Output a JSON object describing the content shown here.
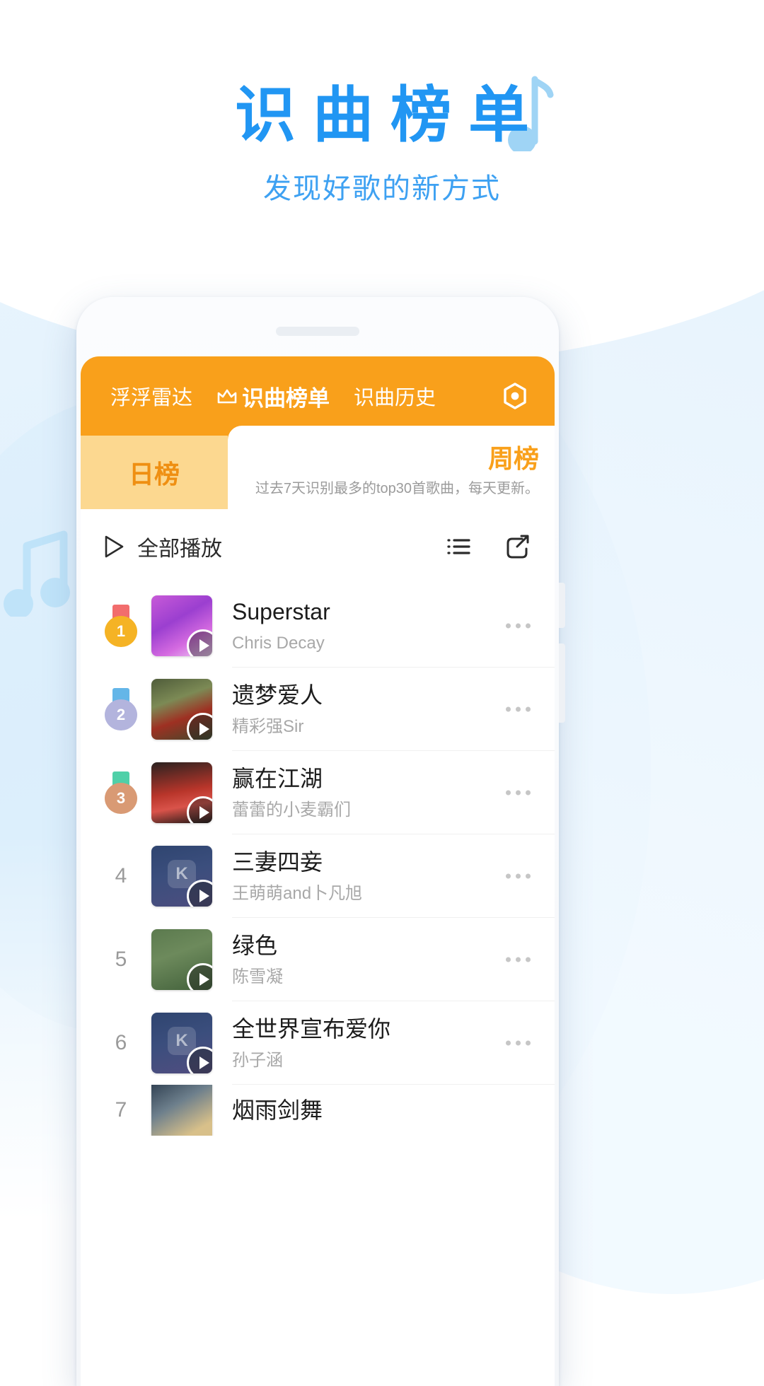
{
  "hero": {
    "title": "识曲榜单",
    "subtitle": "发现好歌的新方式",
    "title_color": "#2196f3",
    "note_icon": "music-note-icon"
  },
  "appbar": {
    "background": "#f9a01b",
    "tabs": [
      {
        "label": "浮浮雷达",
        "active": false
      },
      {
        "label": "识曲榜单",
        "active": true,
        "icon": "crown-icon"
      },
      {
        "label": "识曲历史",
        "active": false
      }
    ],
    "settings_icon": "hex-gear-icon"
  },
  "chart_tabs": {
    "day_label": "日榜",
    "week_label": "周榜",
    "description": "过去7天识别最多的top30首歌曲，每天更新。",
    "active": "周榜",
    "accent_color": "#f9a01b"
  },
  "playbar": {
    "play_all_label": "全部播放",
    "play_icon": "play-triangle-icon",
    "list_icon": "list-icon",
    "share_icon": "share-icon"
  },
  "songs": [
    {
      "rank": "1",
      "title": "Superstar",
      "artist": "Chris Decay",
      "medal": true,
      "medal_disc": "#f5b325",
      "medal_ribbon": "#f26d6d",
      "cover_css": "linear-gradient(150deg,#c85ad8 0%,#9b3fd0 40%,#d46ae0 70%,#efd1f5 100%)"
    },
    {
      "rank": "2",
      "title": "遗梦爱人",
      "artist": "精彩强Sir",
      "medal": true,
      "medal_disc": "#b3b4dd",
      "medal_ribbon": "#64b6e8",
      "cover_css": "linear-gradient(160deg,#4f5c3a 0%,#7c8a55 35%,#9e3022 62%,#3d4a2c 100%)"
    },
    {
      "rank": "3",
      "title": "赢在江湖",
      "artist": "蕾蕾的小麦霸们",
      "medal": true,
      "medal_disc": "#d99a74",
      "medal_ribbon": "#4fd0a8",
      "cover_css": "linear-gradient(170deg,#2a2220 0%,#b8352a 48%,#d9534a 70%,#1b1614 100%)"
    },
    {
      "rank": "4",
      "title": "三妻四妾",
      "artist": "王萌萌and卜凡旭",
      "medal": false,
      "cover_css": "linear-gradient(165deg,#2f4570 0%,#3b4e7d 45%,#4d4d7e 100%)",
      "cover_badge": "K"
    },
    {
      "rank": "5",
      "title": "绿色",
      "artist": "陈雪凝",
      "medal": false,
      "cover_css": "linear-gradient(160deg,#5b7a4e 0%,#6d8a5c 40%,#41603a 100%)"
    },
    {
      "rank": "6",
      "title": "全世界宣布爱你",
      "artist": "孙子涵",
      "medal": false,
      "cover_css": "linear-gradient(165deg,#2f4570 0%,#3b4e7d 45%,#514d80 100%)",
      "cover_badge": "K"
    },
    {
      "rank": "7",
      "title": "烟雨剑舞",
      "artist": "",
      "medal": false,
      "cover_css": "linear-gradient(150deg,#2b3b4d 0%,#6d7f8c 40%,#d8c08a 80%)"
    }
  ]
}
